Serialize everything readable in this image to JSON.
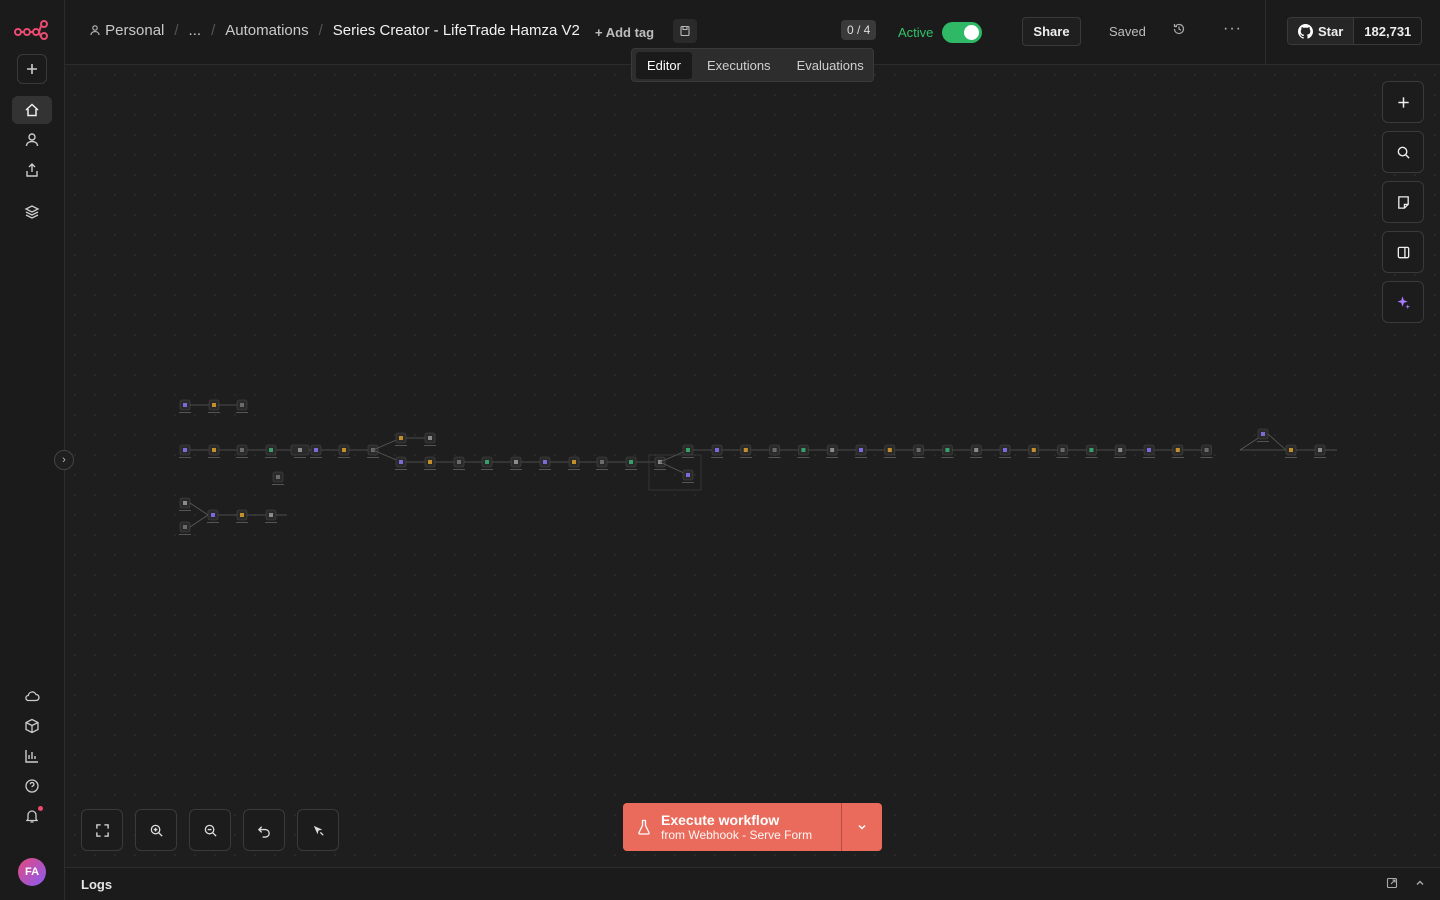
{
  "breadcrumb": {
    "personal": "Personal",
    "ellipsis": "...",
    "folder": "Automations",
    "workflow_title": "Series Creator - LifeTrade Hamza V2"
  },
  "header": {
    "add_tag": "+ Add tag",
    "counter": "0 / 4",
    "active_label": "Active",
    "active": true,
    "share": "Share",
    "saved": "Saved",
    "more": "···"
  },
  "github": {
    "star": "Star",
    "count": "182,731"
  },
  "tabs": [
    {
      "label": "Editor",
      "selected": true
    },
    {
      "label": "Executions",
      "selected": false
    },
    {
      "label": "Evaluations",
      "selected": false
    }
  ],
  "execute": {
    "label": "Execute workflow",
    "sublabel": "from Webhook - Serve Form"
  },
  "logs": {
    "title": "Logs"
  },
  "user": {
    "initials": "FA"
  },
  "colors": {
    "accent": "#ea6b5b",
    "active_green": "#2fb967",
    "ai_purple": "#a77cff",
    "canvas_bg": "#1e1e1e"
  },
  "icons": {
    "sidebar_top": [
      "plus-icon",
      "home-icon",
      "user-icon",
      "share-icon",
      "layers-icon"
    ],
    "sidebar_bottom": [
      "cloud-icon",
      "box-icon",
      "chart-icon",
      "help-icon",
      "bell-icon"
    ],
    "right_tools": [
      "plus-icon",
      "search-icon",
      "sticky-note-icon",
      "panel-icon",
      "sparkle-icon"
    ],
    "zoom_controls": [
      "fit-view-icon",
      "zoom-in-icon",
      "zoom-out-icon",
      "undo-icon",
      "tidy-up-icon"
    ]
  }
}
